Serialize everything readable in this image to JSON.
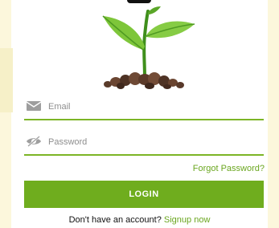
{
  "form": {
    "email_placeholder": "Email",
    "password_placeholder": "Password",
    "forgot_password_label": "Forgot Password?",
    "login_button_label": "LOGIN",
    "no_account_text": "Don't have an account?",
    "signup_link_label": "Signup now"
  },
  "icons": {
    "email": "envelope-icon",
    "password": "eye-off-icon",
    "hero": "sprout-plant-illustration"
  },
  "colors": {
    "accent": "#6fad1e",
    "link": "#6aa61f",
    "field_line": "#7cb526",
    "side_background": "#fcf7dc",
    "placeholder": "#8e8e8e"
  }
}
